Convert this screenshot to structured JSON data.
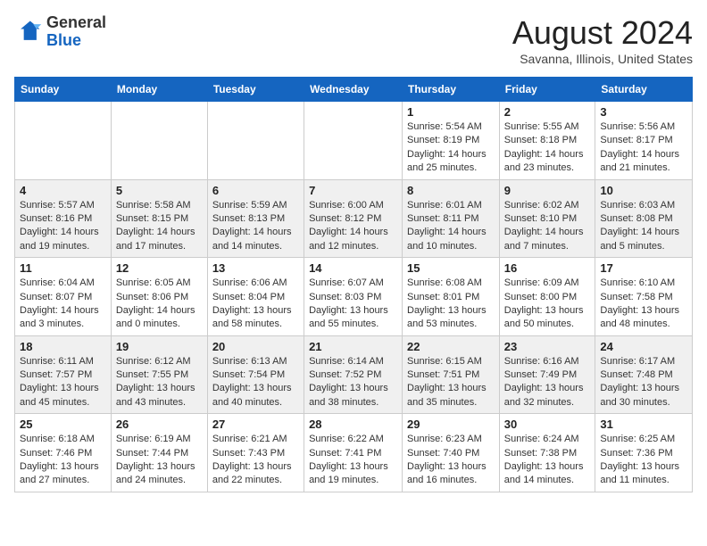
{
  "header": {
    "logo_line1": "General",
    "logo_line2": "Blue",
    "month_title": "August 2024",
    "location": "Savanna, Illinois, United States"
  },
  "weekdays": [
    "Sunday",
    "Monday",
    "Tuesday",
    "Wednesday",
    "Thursday",
    "Friday",
    "Saturday"
  ],
  "weeks": [
    [
      {
        "day": "",
        "info": ""
      },
      {
        "day": "",
        "info": ""
      },
      {
        "day": "",
        "info": ""
      },
      {
        "day": "",
        "info": ""
      },
      {
        "day": "1",
        "info": "Sunrise: 5:54 AM\nSunset: 8:19 PM\nDaylight: 14 hours and 25 minutes."
      },
      {
        "day": "2",
        "info": "Sunrise: 5:55 AM\nSunset: 8:18 PM\nDaylight: 14 hours and 23 minutes."
      },
      {
        "day": "3",
        "info": "Sunrise: 5:56 AM\nSunset: 8:17 PM\nDaylight: 14 hours and 21 minutes."
      }
    ],
    [
      {
        "day": "4",
        "info": "Sunrise: 5:57 AM\nSunset: 8:16 PM\nDaylight: 14 hours and 19 minutes."
      },
      {
        "day": "5",
        "info": "Sunrise: 5:58 AM\nSunset: 8:15 PM\nDaylight: 14 hours and 17 minutes."
      },
      {
        "day": "6",
        "info": "Sunrise: 5:59 AM\nSunset: 8:13 PM\nDaylight: 14 hours and 14 minutes."
      },
      {
        "day": "7",
        "info": "Sunrise: 6:00 AM\nSunset: 8:12 PM\nDaylight: 14 hours and 12 minutes."
      },
      {
        "day": "8",
        "info": "Sunrise: 6:01 AM\nSunset: 8:11 PM\nDaylight: 14 hours and 10 minutes."
      },
      {
        "day": "9",
        "info": "Sunrise: 6:02 AM\nSunset: 8:10 PM\nDaylight: 14 hours and 7 minutes."
      },
      {
        "day": "10",
        "info": "Sunrise: 6:03 AM\nSunset: 8:08 PM\nDaylight: 14 hours and 5 minutes."
      }
    ],
    [
      {
        "day": "11",
        "info": "Sunrise: 6:04 AM\nSunset: 8:07 PM\nDaylight: 14 hours and 3 minutes."
      },
      {
        "day": "12",
        "info": "Sunrise: 6:05 AM\nSunset: 8:06 PM\nDaylight: 14 hours and 0 minutes."
      },
      {
        "day": "13",
        "info": "Sunrise: 6:06 AM\nSunset: 8:04 PM\nDaylight: 13 hours and 58 minutes."
      },
      {
        "day": "14",
        "info": "Sunrise: 6:07 AM\nSunset: 8:03 PM\nDaylight: 13 hours and 55 minutes."
      },
      {
        "day": "15",
        "info": "Sunrise: 6:08 AM\nSunset: 8:01 PM\nDaylight: 13 hours and 53 minutes."
      },
      {
        "day": "16",
        "info": "Sunrise: 6:09 AM\nSunset: 8:00 PM\nDaylight: 13 hours and 50 minutes."
      },
      {
        "day": "17",
        "info": "Sunrise: 6:10 AM\nSunset: 7:58 PM\nDaylight: 13 hours and 48 minutes."
      }
    ],
    [
      {
        "day": "18",
        "info": "Sunrise: 6:11 AM\nSunset: 7:57 PM\nDaylight: 13 hours and 45 minutes."
      },
      {
        "day": "19",
        "info": "Sunrise: 6:12 AM\nSunset: 7:55 PM\nDaylight: 13 hours and 43 minutes."
      },
      {
        "day": "20",
        "info": "Sunrise: 6:13 AM\nSunset: 7:54 PM\nDaylight: 13 hours and 40 minutes."
      },
      {
        "day": "21",
        "info": "Sunrise: 6:14 AM\nSunset: 7:52 PM\nDaylight: 13 hours and 38 minutes."
      },
      {
        "day": "22",
        "info": "Sunrise: 6:15 AM\nSunset: 7:51 PM\nDaylight: 13 hours and 35 minutes."
      },
      {
        "day": "23",
        "info": "Sunrise: 6:16 AM\nSunset: 7:49 PM\nDaylight: 13 hours and 32 minutes."
      },
      {
        "day": "24",
        "info": "Sunrise: 6:17 AM\nSunset: 7:48 PM\nDaylight: 13 hours and 30 minutes."
      }
    ],
    [
      {
        "day": "25",
        "info": "Sunrise: 6:18 AM\nSunset: 7:46 PM\nDaylight: 13 hours and 27 minutes."
      },
      {
        "day": "26",
        "info": "Sunrise: 6:19 AM\nSunset: 7:44 PM\nDaylight: 13 hours and 24 minutes."
      },
      {
        "day": "27",
        "info": "Sunrise: 6:21 AM\nSunset: 7:43 PM\nDaylight: 13 hours and 22 minutes."
      },
      {
        "day": "28",
        "info": "Sunrise: 6:22 AM\nSunset: 7:41 PM\nDaylight: 13 hours and 19 minutes."
      },
      {
        "day": "29",
        "info": "Sunrise: 6:23 AM\nSunset: 7:40 PM\nDaylight: 13 hours and 16 minutes."
      },
      {
        "day": "30",
        "info": "Sunrise: 6:24 AM\nSunset: 7:38 PM\nDaylight: 13 hours and 14 minutes."
      },
      {
        "day": "31",
        "info": "Sunrise: 6:25 AM\nSunset: 7:36 PM\nDaylight: 13 hours and 11 minutes."
      }
    ]
  ]
}
